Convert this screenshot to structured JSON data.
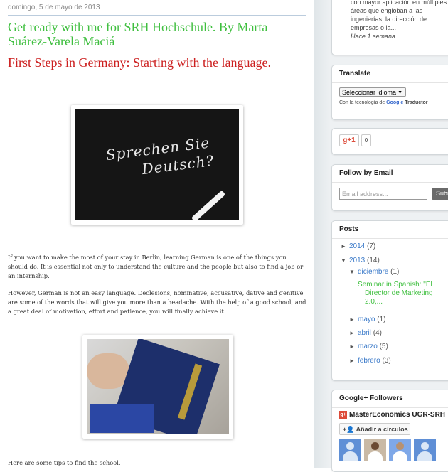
{
  "post": {
    "date": "domingo, 5 de mayo de 2013",
    "title": "Get ready with me for SRH Hochschule. By Marta Suárez-Varela Maciá",
    "subtitle": "First Steps in Germany: Starting with the language.",
    "image1_text_line1": "Sprechen Sie",
    "image1_text_line2": "Deutsch?",
    "image2_alt": "Person reading a German dictionary",
    "para1": "If you want to make the most of your stay in Berlin, learning German is one of the things you should do. It is essential not only to understand the culture and the people but also to find a job or an internship.",
    "para2": "However, German is not an easy language. Declesions, nominative, accusative, dative and genitive are some of the words that will give you more than a headache. With the help of a good school, and a great deal of motivation, effort and patience, you will finally achieve it.",
    "para3": "Here are some tips to find the school."
  },
  "sidebar": {
    "popular_snippet": {
      "line1": "con mayor aplicación en múltiples",
      "line2": "áreas que engloban a las",
      "line3": "ingenierías, la dirección de",
      "line4": "empresas o la...",
      "ago": "Hace 1 semana"
    },
    "translate": {
      "heading": "Translate",
      "select_label": "Seleccionar idioma",
      "powered_prefix": "Con la tecnología de",
      "google": "Google",
      "traductor": "Traductor"
    },
    "gplus": {
      "label": "g+1",
      "count": "0"
    },
    "follow": {
      "heading": "Follow by Email",
      "placeholder": "Email address...",
      "submit": "Submit"
    },
    "posts": {
      "heading": "Posts",
      "y2014": {
        "label": "2014",
        "count": "(7)"
      },
      "y2013": {
        "label": "2013",
        "count": "(14)"
      },
      "diciembre": {
        "label": "diciembre",
        "count": "(1)"
      },
      "post_link_line1": "Seminar in Spanish: \"El",
      "post_link_line2": "Director de Marketing",
      "post_link_line3": "2.0,...",
      "mayo": {
        "label": "mayo",
        "count": "(1)"
      },
      "abril": {
        "label": "abril",
        "count": "(4)"
      },
      "marzo": {
        "label": "marzo",
        "count": "(5)"
      },
      "febrero": {
        "label": "febrero",
        "count": "(3)"
      }
    },
    "followers": {
      "heading": "Google+ Followers",
      "logo": "g+",
      "name": "MasterEconomics UGR-SRH",
      "button": "Añadir a círculos"
    }
  }
}
